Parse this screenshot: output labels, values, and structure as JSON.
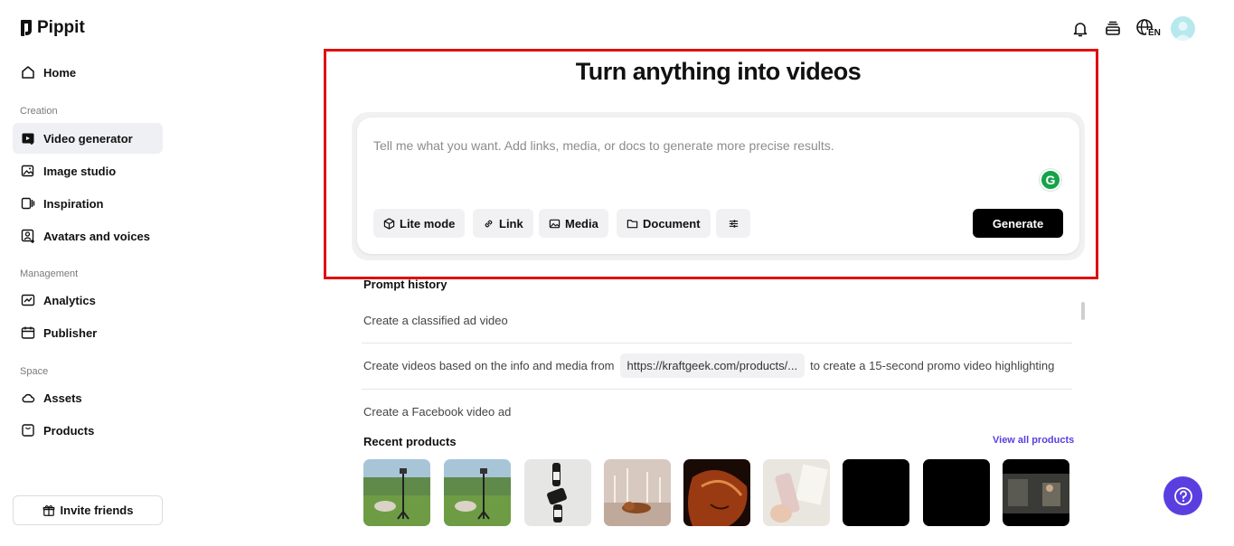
{
  "app": {
    "name": "Pippit"
  },
  "sidebar": {
    "home": "Home",
    "sections": {
      "creation": "Creation",
      "management": "Management",
      "space": "Space"
    },
    "creation_items": [
      "Video generator",
      "Image studio",
      "Inspiration",
      "Avatars and voices"
    ],
    "management_items": [
      "Analytics",
      "Publisher"
    ],
    "space_items": [
      "Assets",
      "Products"
    ],
    "invite": "Invite friends"
  },
  "header": {
    "language": "EN",
    "icons": [
      "bell-icon",
      "stack-icon",
      "globe-icon",
      "avatar"
    ]
  },
  "main": {
    "title": "Turn anything into videos",
    "prompt": {
      "placeholder": "Tell me what you want. Add links, media, or docs to generate more precise results.",
      "chips": [
        "Lite mode",
        "Link",
        "Media",
        "Document"
      ],
      "generate": "Generate"
    },
    "prompt_history": {
      "title": "Prompt history",
      "items": [
        "Create a classified ad video",
        {
          "before": "Create videos based on the info and media from",
          "url": "https://kraftgeek.com/products/...",
          "after": "to create a 15-second promo video highlighting"
        },
        "Create a Facebook video ad"
      ]
    },
    "recent_products": {
      "title": "Recent products",
      "view_all": "View all products"
    }
  },
  "colors": {
    "accent": "#5b3ee0",
    "highlight": "#e01010",
    "active_nav": "#eef0f3"
  }
}
